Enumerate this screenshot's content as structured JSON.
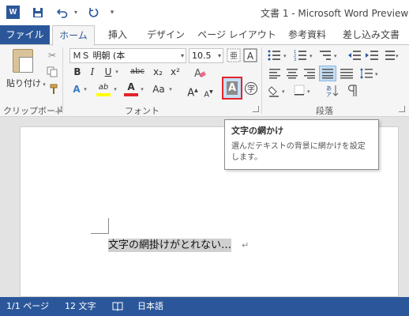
{
  "window": {
    "title": "文書 1 - Microsoft Word Preview",
    "app_badge": "W"
  },
  "qat": {
    "save_icon": "floppy-icon",
    "undo_icon": "undo-icon",
    "redo_icon": "redo-icon",
    "customize_icon": "qat-customize-icon"
  },
  "tabs": {
    "file": "ファイル",
    "items": [
      "ホーム",
      "挿入",
      "デザイン",
      "ページ レイアウト",
      "参考資料",
      "差し込み文書"
    ]
  },
  "clipboard": {
    "paste_label": "貼り付け",
    "group_label": "クリップボード"
  },
  "font": {
    "name": "ＭＳ 明朝 (本",
    "size": "10.5",
    "group_label": "フォント",
    "bold": "B",
    "italic": "I",
    "underline": "U",
    "strike": "abc",
    "subscript": "x₂",
    "superscript": "x²",
    "text_effects": "A",
    "highlight": "ab",
    "font_color": "A",
    "change_case": "Aa",
    "grow": "A",
    "shrink": "A",
    "char_shading": "A",
    "enclosed_char": "字",
    "clear_format": "A"
  },
  "paragraph": {
    "group_label": "段落"
  },
  "tooltip": {
    "title": "文字の網かけ",
    "description": "選んだテキストの背景に網かけを設定します。"
  },
  "document": {
    "text": "文字の網掛けがとれない…",
    "para_mark": "↵"
  },
  "status": {
    "page": "1/1 ページ",
    "words": "12 文字",
    "language": "日本語"
  },
  "colors": {
    "brand": "#2b579a",
    "highlight_red": "#e3242b",
    "highlight_yellow": "#ffff00"
  }
}
